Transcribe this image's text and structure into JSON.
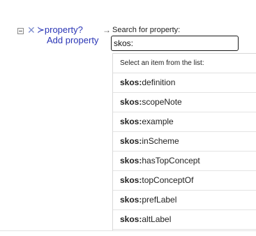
{
  "row": {
    "remove_glyph": "✕",
    "property_label": "≻property?",
    "arrow_glyph": "→",
    "add_property_label": "Add property"
  },
  "search": {
    "label": "Search for property:",
    "value": "skos:"
  },
  "dropdown": {
    "header": "Select an item from the list:",
    "items": [
      {
        "prefix": "skos:",
        "name": "definition"
      },
      {
        "prefix": "skos:",
        "name": "scopeNote"
      },
      {
        "prefix": "skos:",
        "name": "example"
      },
      {
        "prefix": "skos:",
        "name": "inScheme"
      },
      {
        "prefix": "skos:",
        "name": "hasTopConcept"
      },
      {
        "prefix": "skos:",
        "name": "topConceptOf"
      },
      {
        "prefix": "skos:",
        "name": "prefLabel"
      },
      {
        "prefix": "skos:",
        "name": "altLabel"
      }
    ]
  },
  "colors": {
    "link": "#2a35b5",
    "remove_icon": "#7f8fce"
  }
}
